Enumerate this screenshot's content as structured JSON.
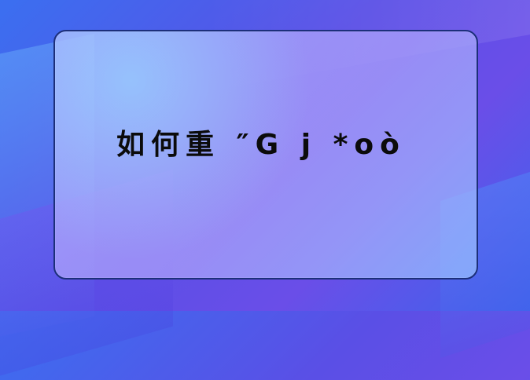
{
  "card": {
    "title": "如何重 ″G j *oò"
  }
}
